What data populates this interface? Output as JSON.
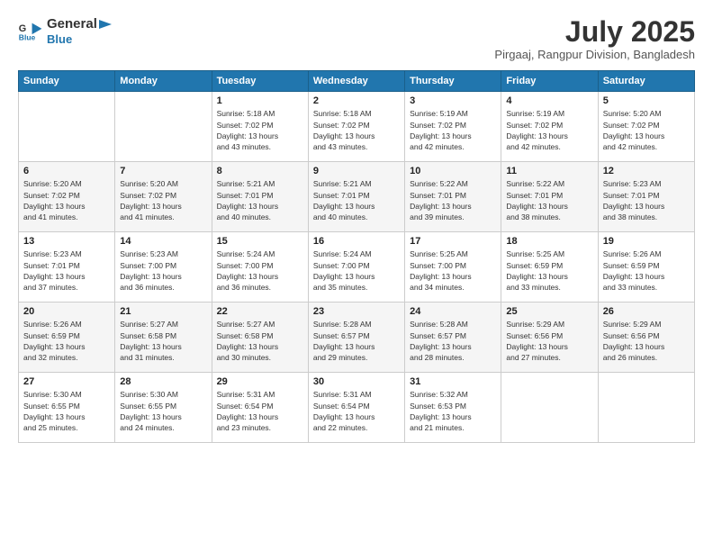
{
  "header": {
    "logo_line1": "General",
    "logo_line2": "Blue",
    "month_title": "July 2025",
    "location": "Pirgaaj, Rangpur Division, Bangladesh"
  },
  "weekdays": [
    "Sunday",
    "Monday",
    "Tuesday",
    "Wednesday",
    "Thursday",
    "Friday",
    "Saturday"
  ],
  "weeks": [
    [
      {
        "day": "",
        "info": ""
      },
      {
        "day": "",
        "info": ""
      },
      {
        "day": "1",
        "info": "Sunrise: 5:18 AM\nSunset: 7:02 PM\nDaylight: 13 hours\nand 43 minutes."
      },
      {
        "day": "2",
        "info": "Sunrise: 5:18 AM\nSunset: 7:02 PM\nDaylight: 13 hours\nand 43 minutes."
      },
      {
        "day": "3",
        "info": "Sunrise: 5:19 AM\nSunset: 7:02 PM\nDaylight: 13 hours\nand 42 minutes."
      },
      {
        "day": "4",
        "info": "Sunrise: 5:19 AM\nSunset: 7:02 PM\nDaylight: 13 hours\nand 42 minutes."
      },
      {
        "day": "5",
        "info": "Sunrise: 5:20 AM\nSunset: 7:02 PM\nDaylight: 13 hours\nand 42 minutes."
      }
    ],
    [
      {
        "day": "6",
        "info": "Sunrise: 5:20 AM\nSunset: 7:02 PM\nDaylight: 13 hours\nand 41 minutes."
      },
      {
        "day": "7",
        "info": "Sunrise: 5:20 AM\nSunset: 7:02 PM\nDaylight: 13 hours\nand 41 minutes."
      },
      {
        "day": "8",
        "info": "Sunrise: 5:21 AM\nSunset: 7:01 PM\nDaylight: 13 hours\nand 40 minutes."
      },
      {
        "day": "9",
        "info": "Sunrise: 5:21 AM\nSunset: 7:01 PM\nDaylight: 13 hours\nand 40 minutes."
      },
      {
        "day": "10",
        "info": "Sunrise: 5:22 AM\nSunset: 7:01 PM\nDaylight: 13 hours\nand 39 minutes."
      },
      {
        "day": "11",
        "info": "Sunrise: 5:22 AM\nSunset: 7:01 PM\nDaylight: 13 hours\nand 38 minutes."
      },
      {
        "day": "12",
        "info": "Sunrise: 5:23 AM\nSunset: 7:01 PM\nDaylight: 13 hours\nand 38 minutes."
      }
    ],
    [
      {
        "day": "13",
        "info": "Sunrise: 5:23 AM\nSunset: 7:01 PM\nDaylight: 13 hours\nand 37 minutes."
      },
      {
        "day": "14",
        "info": "Sunrise: 5:23 AM\nSunset: 7:00 PM\nDaylight: 13 hours\nand 36 minutes."
      },
      {
        "day": "15",
        "info": "Sunrise: 5:24 AM\nSunset: 7:00 PM\nDaylight: 13 hours\nand 36 minutes."
      },
      {
        "day": "16",
        "info": "Sunrise: 5:24 AM\nSunset: 7:00 PM\nDaylight: 13 hours\nand 35 minutes."
      },
      {
        "day": "17",
        "info": "Sunrise: 5:25 AM\nSunset: 7:00 PM\nDaylight: 13 hours\nand 34 minutes."
      },
      {
        "day": "18",
        "info": "Sunrise: 5:25 AM\nSunset: 6:59 PM\nDaylight: 13 hours\nand 33 minutes."
      },
      {
        "day": "19",
        "info": "Sunrise: 5:26 AM\nSunset: 6:59 PM\nDaylight: 13 hours\nand 33 minutes."
      }
    ],
    [
      {
        "day": "20",
        "info": "Sunrise: 5:26 AM\nSunset: 6:59 PM\nDaylight: 13 hours\nand 32 minutes."
      },
      {
        "day": "21",
        "info": "Sunrise: 5:27 AM\nSunset: 6:58 PM\nDaylight: 13 hours\nand 31 minutes."
      },
      {
        "day": "22",
        "info": "Sunrise: 5:27 AM\nSunset: 6:58 PM\nDaylight: 13 hours\nand 30 minutes."
      },
      {
        "day": "23",
        "info": "Sunrise: 5:28 AM\nSunset: 6:57 PM\nDaylight: 13 hours\nand 29 minutes."
      },
      {
        "day": "24",
        "info": "Sunrise: 5:28 AM\nSunset: 6:57 PM\nDaylight: 13 hours\nand 28 minutes."
      },
      {
        "day": "25",
        "info": "Sunrise: 5:29 AM\nSunset: 6:56 PM\nDaylight: 13 hours\nand 27 minutes."
      },
      {
        "day": "26",
        "info": "Sunrise: 5:29 AM\nSunset: 6:56 PM\nDaylight: 13 hours\nand 26 minutes."
      }
    ],
    [
      {
        "day": "27",
        "info": "Sunrise: 5:30 AM\nSunset: 6:55 PM\nDaylight: 13 hours\nand 25 minutes."
      },
      {
        "day": "28",
        "info": "Sunrise: 5:30 AM\nSunset: 6:55 PM\nDaylight: 13 hours\nand 24 minutes."
      },
      {
        "day": "29",
        "info": "Sunrise: 5:31 AM\nSunset: 6:54 PM\nDaylight: 13 hours\nand 23 minutes."
      },
      {
        "day": "30",
        "info": "Sunrise: 5:31 AM\nSunset: 6:54 PM\nDaylight: 13 hours\nand 22 minutes."
      },
      {
        "day": "31",
        "info": "Sunrise: 5:32 AM\nSunset: 6:53 PM\nDaylight: 13 hours\nand 21 minutes."
      },
      {
        "day": "",
        "info": ""
      },
      {
        "day": "",
        "info": ""
      }
    ]
  ]
}
